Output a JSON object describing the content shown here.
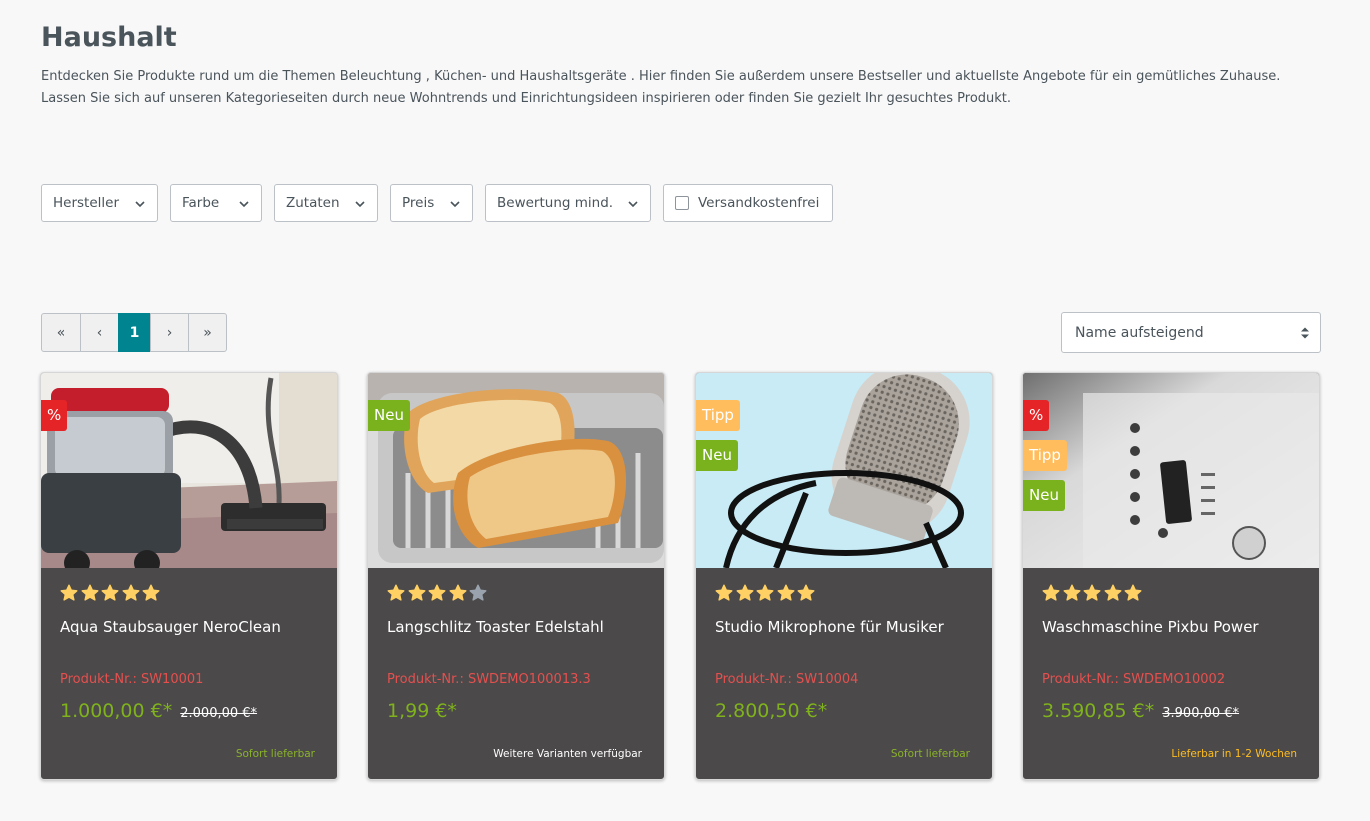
{
  "page": {
    "title": "Haushalt",
    "intro_line1": "Entdecken Sie Produkte rund um die Themen Beleuchtung , Küchen- und Haushaltsgeräte . Hier finden Sie außerdem unsere Bestseller und aktuellste Angebote für ein gemütliches Zuhause.",
    "intro_line2": "Lassen Sie sich auf unseren Kategorieseiten durch neue Wohntrends und Einrichtungsideen inspirieren oder finden Sie gezielt Ihr gesuchtes Produkt."
  },
  "filters": {
    "manufacturer": "Hersteller",
    "color": "Farbe",
    "ingredients": "Zutaten",
    "price": "Preis",
    "rating": "Bewertung mind.",
    "free_shipping": "Versandkostenfrei"
  },
  "pagination": {
    "first": "«",
    "prev": "‹",
    "current": "1",
    "next": "›",
    "last": "»"
  },
  "sorting": {
    "selected": "Name aufsteigend"
  },
  "colors": {
    "accent": "#008490",
    "card_bg": "#4b4949",
    "price": "#7fb21c",
    "product_number": "#e5504f",
    "badge_discount": "#e52427",
    "badge_new": "#79b21c",
    "badge_tip": "#ffbd5d",
    "star": "#ffd063",
    "star_empty": "#9aa3ad"
  },
  "products": [
    {
      "name": "Aqua Staubsauger NeroClean",
      "number": "Produkt-Nr.: SW10001",
      "price": "1.000,00 €*",
      "old_price": "2.000,00 €*",
      "rating": 5,
      "badges": [
        "%"
      ],
      "delivery": "Sofort lieferbar",
      "delivery_color": "#8ab32a",
      "image": "vacuum-cleaner"
    },
    {
      "name": "Langschlitz Toaster Edelstahl",
      "number": "Produkt-Nr.: SWDEMO100013.3",
      "price": "1,99 €*",
      "old_price": "",
      "rating": 4,
      "badges": [
        "Neu"
      ],
      "delivery": "Weitere Varianten verfügbar",
      "delivery_color": "#ffffff",
      "image": "toaster"
    },
    {
      "name": "Studio Mikrophone für Musiker",
      "number": "Produkt-Nr.: SW10004",
      "price": "2.800,50 €*",
      "old_price": "",
      "rating": 5,
      "badges": [
        "Tipp",
        "Neu"
      ],
      "delivery": "Sofort lieferbar",
      "delivery_color": "#8ab32a",
      "image": "microphone"
    },
    {
      "name": "Waschmaschine Pixbu Power",
      "number": "Produkt-Nr.: SWDEMO10002",
      "price": "3.590,85 €*",
      "old_price": "3.900,00 €*",
      "rating": 5,
      "badges": [
        "%",
        "Tipp",
        "Neu"
      ],
      "delivery": "Lieferbar in 1-2 Wochen",
      "delivery_color": "#ffbd1f",
      "image": "washing-machine"
    }
  ]
}
